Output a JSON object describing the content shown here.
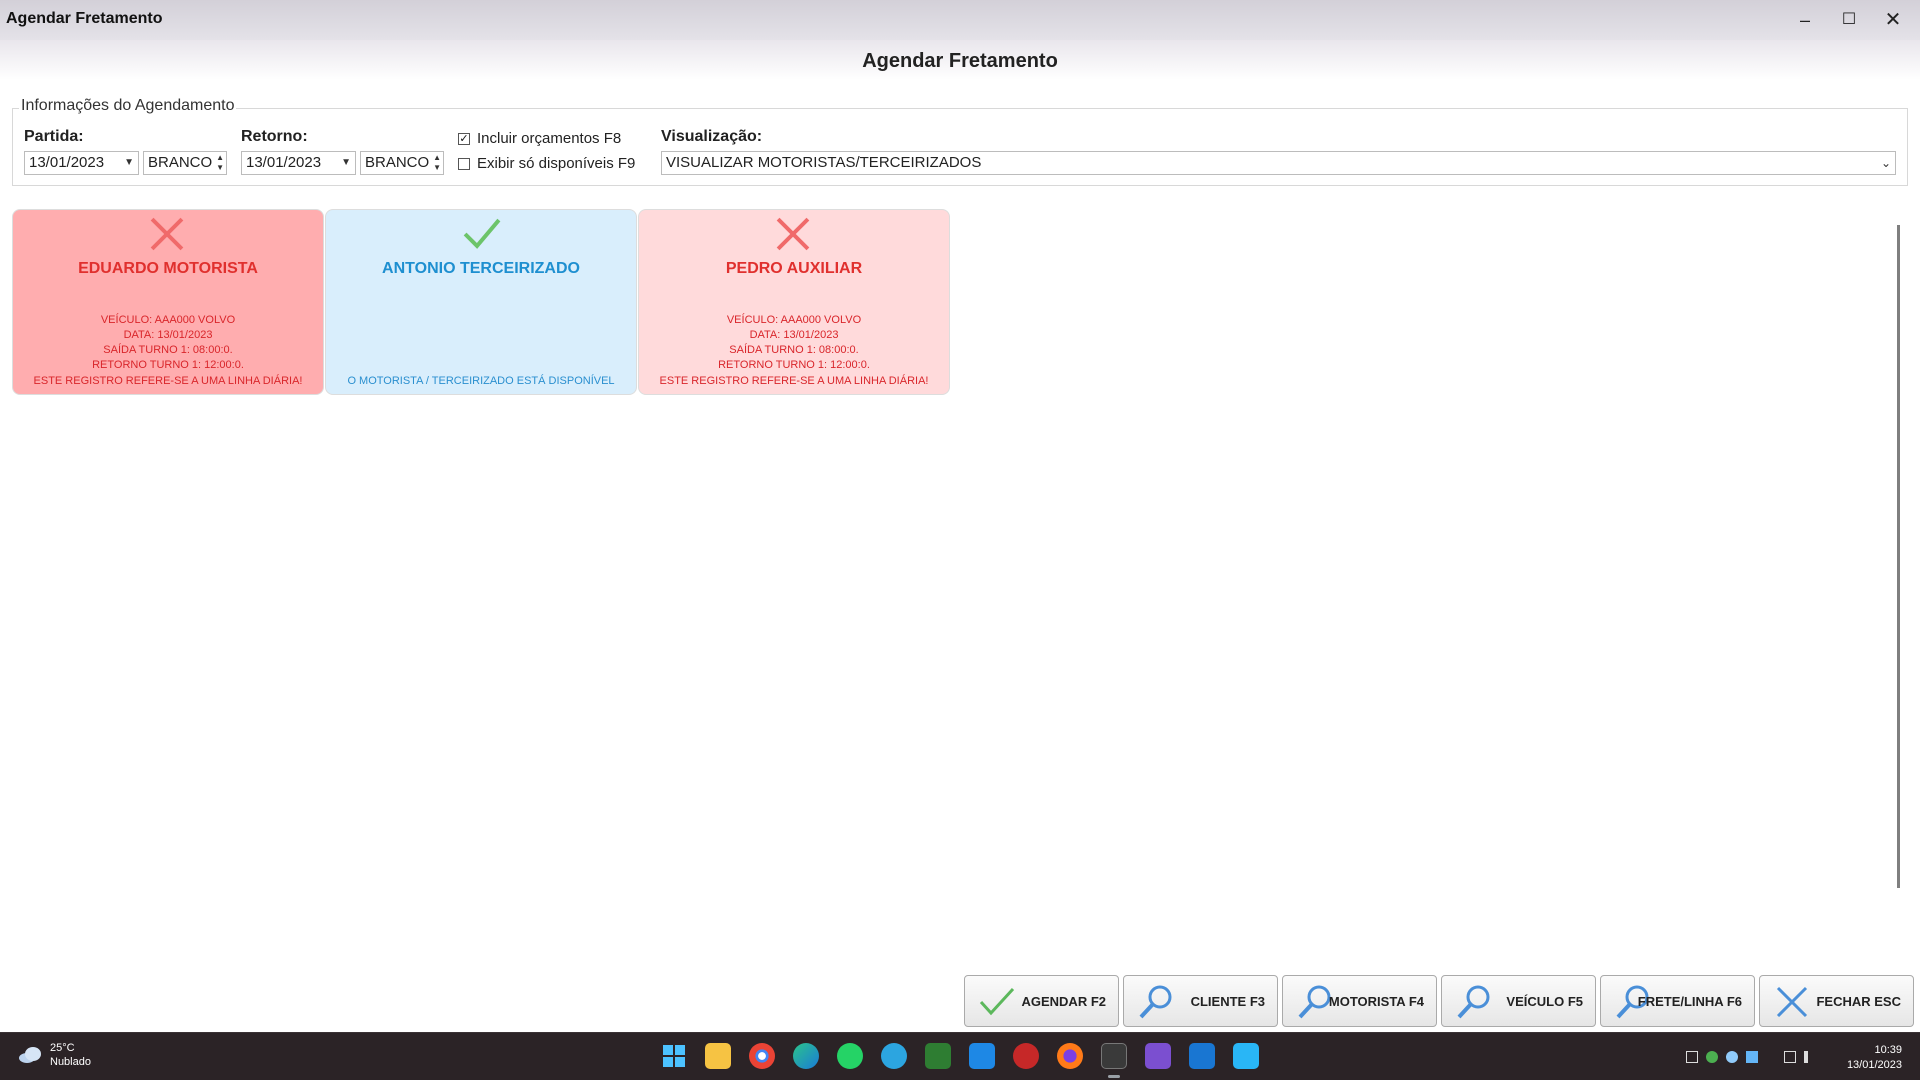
{
  "window": {
    "title": "Agendar Fretamento",
    "controls": {
      "minimize": "–",
      "maximize": "☐",
      "close": "✕"
    }
  },
  "page": {
    "title": "Agendar Fretamento"
  },
  "group": {
    "legend": "Informações do Agendamento",
    "partida": {
      "label": "Partida:",
      "date": "13/01/2023",
      "turno": "BRANCO"
    },
    "retorno": {
      "label": "Retorno:",
      "date": "13/01/2023",
      "turno": "BRANCO"
    },
    "incluir_orcamentos": {
      "label": "Incluir orçamentos F8",
      "checked": true,
      "mark": "✓"
    },
    "exibir_disponiveis": {
      "label": "Exibir só disponíveis F9",
      "checked": false,
      "mark": ""
    },
    "visualizacao": {
      "label": "Visualização:",
      "value": "VISUALIZAR MOTORISTAS/TERCEIRIZADOS"
    }
  },
  "cards": [
    {
      "status": "unavailable",
      "icon": "x-icon",
      "name": "EDUARDO MOTORISTA",
      "details": [
        "VEÍCULO: AAA000 VOLVO",
        "DATA: 13/01/2023",
        "SAÍDA TURNO 1: 08:00:0.",
        "RETORNO TURNO 1: 12:00:0."
      ],
      "note": "ESTE REGISTRO REFERE-SE A UMA LINHA DIÁRIA!"
    },
    {
      "status": "available",
      "icon": "check-icon",
      "name": "ANTONIO TERCEIRIZADO",
      "details": [],
      "note": "O MOTORISTA / TERCEIRIZADO ESTÁ DISPONÍVEL"
    },
    {
      "status": "unavailable",
      "icon": "x-icon",
      "name": "PEDRO AUXILIAR",
      "details": [
        "VEÍCULO: AAA000 VOLVO",
        "DATA: 13/01/2023",
        "SAÍDA TURNO 1: 08:00:0.",
        "RETORNO TURNO 1: 12:00:0."
      ],
      "note": "ESTE REGISTRO REFERE-SE A UMA LINHA DIÁRIA!"
    }
  ],
  "buttons": {
    "agendar": "AGENDAR F2",
    "cliente": "CLIENTE F3",
    "motorista": "MOTORISTA F4",
    "veiculo": "VEÍCULO F5",
    "frete": "FRETE/LINHA F6",
    "fechar": "FECHAR ESC"
  },
  "taskbar": {
    "weather": {
      "temp": "25°C",
      "condition": "Nublado"
    },
    "time": "10:39",
    "date": "13/01/2023",
    "apps": [
      "start-icon",
      "file-explorer-icon",
      "chrome-icon",
      "edge-icon",
      "whatsapp-icon",
      "telegram-icon",
      "spreadsheet-icon",
      "mail-icon",
      "app-red-icon",
      "firefox-icon",
      "app-active-icon",
      "media-icon",
      "remote-desktop-icon",
      "notepad-icon"
    ]
  },
  "colors": {
    "card_unavailable": "#ffadaf",
    "card_available": "#d9eefc",
    "card_unavailable_light": "#ffdadb",
    "name_red": "#e0302e",
    "name_blue": "#1e8fd0"
  }
}
